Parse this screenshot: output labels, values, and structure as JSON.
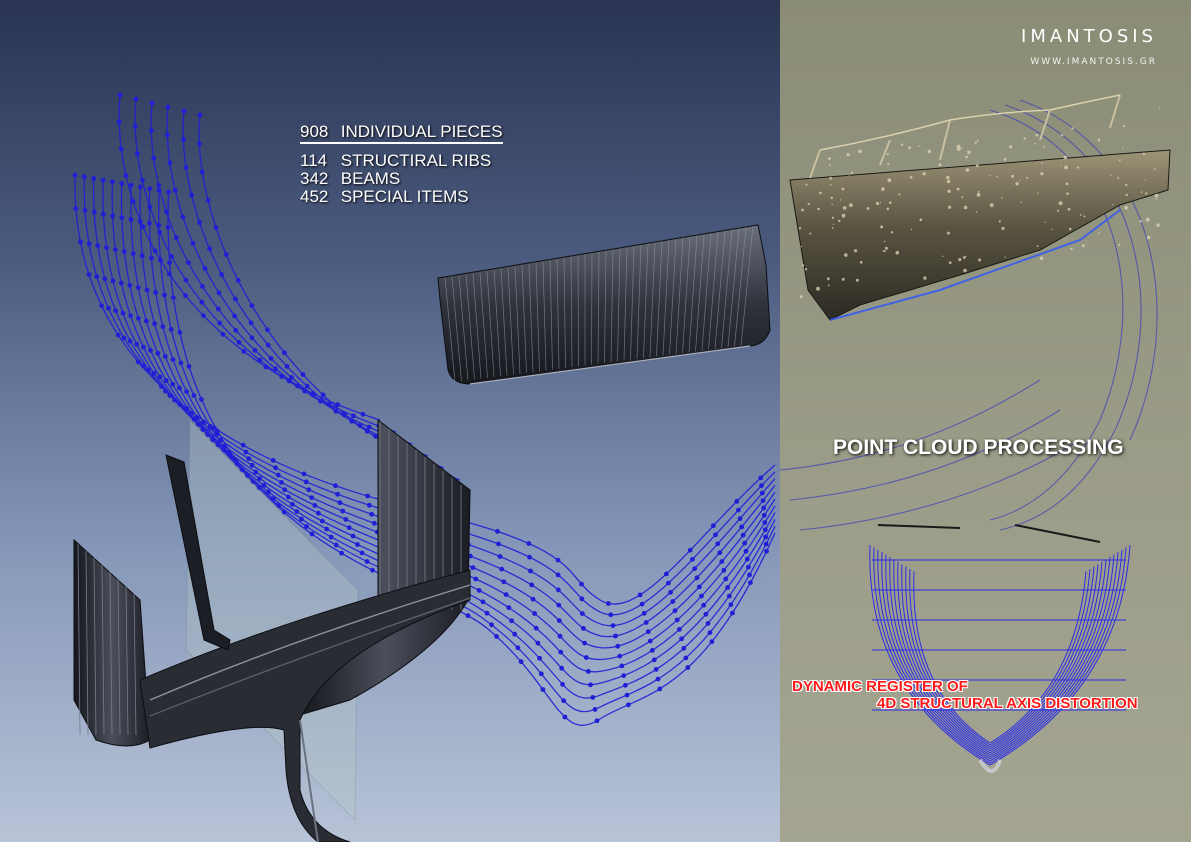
{
  "brand": {
    "name": "IMANTOSIS",
    "url": "WWW.IMANTOSIS.GR"
  },
  "stats": {
    "headline": {
      "count": "908",
      "label": "INDIVIDUAL PIECES"
    },
    "items": [
      {
        "count": "114",
        "label": "STRUCTIRAL RIBS"
      },
      {
        "count": "342",
        "label": "BEAMS"
      },
      {
        "count": "452",
        "label": "SPECIAL ITEMS"
      }
    ]
  },
  "point_cloud": {
    "title": "POINT CLOUD PROCESSING"
  },
  "distortion_note": {
    "line1": "DYNAMIC REGISTER OF",
    "line2": "4D STRUCTURAL AXIS DISTORTION"
  },
  "colors": {
    "wireframe": "#1f1fd6",
    "rib_dark": "#1b1d24",
    "rib_light": "#6a6f7c",
    "bg_left_top": "#2a3452",
    "bg_left_bottom": "#b8c3d7",
    "bg_right": "#9a9b86",
    "note_red": "#ff1a1a"
  }
}
